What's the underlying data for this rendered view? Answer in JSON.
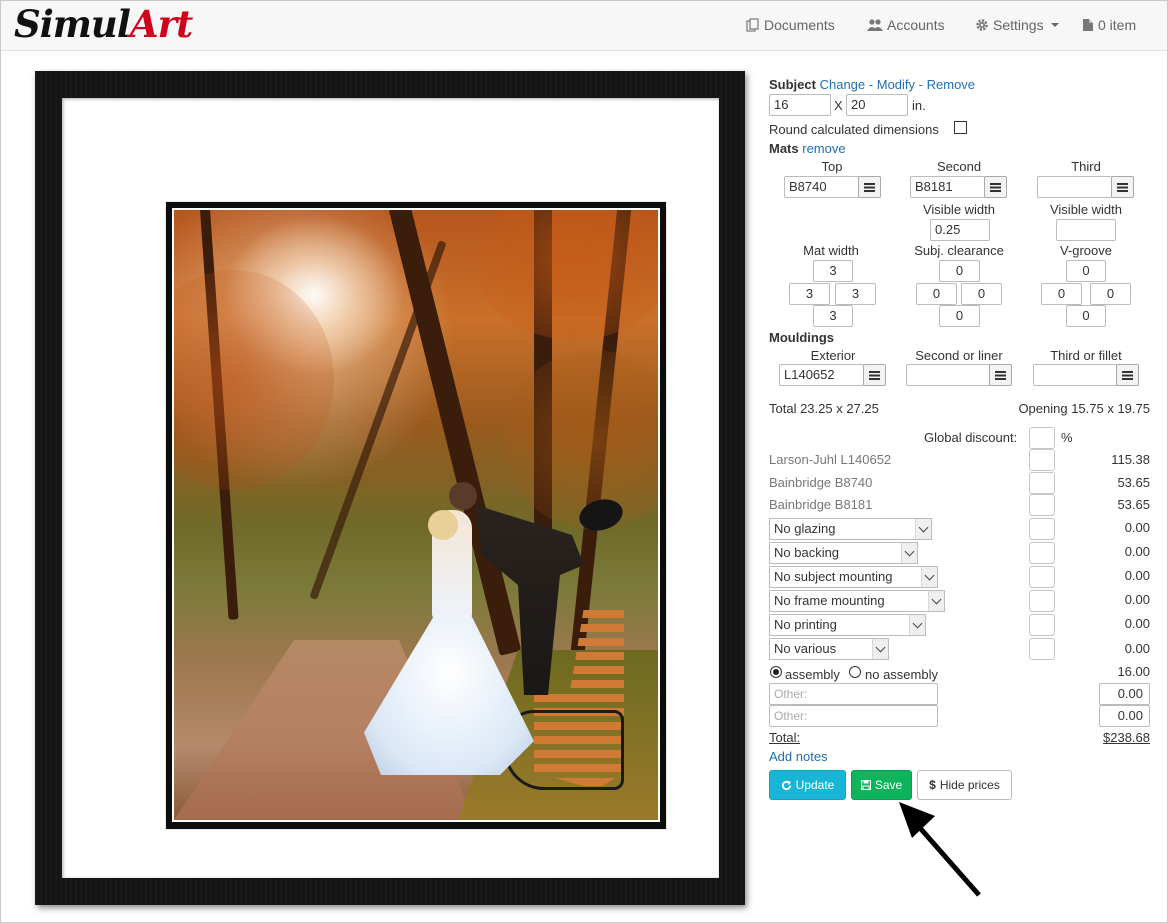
{
  "brand": {
    "part1": "Simul",
    "part2": "Art"
  },
  "nav": {
    "documents": "Documents",
    "accounts": "Accounts",
    "settings": "Settings",
    "cart": "0 item"
  },
  "subject": {
    "label": "Subject",
    "change": "Change",
    "sep1": "-",
    "modify": "Modify",
    "sep2": "-",
    "remove": "Remove",
    "width": "16",
    "times": "X",
    "height": "20",
    "unit": "in.",
    "round_label": "Round calculated dimensions"
  },
  "mats": {
    "label": "Mats",
    "remove": "remove",
    "col_top": "Top",
    "col_second": "Second",
    "col_third": "Third",
    "top_code": "B8740",
    "second_code": "B8181",
    "third_code": "",
    "visible_width_label": "Visible width",
    "second_visible_width": "0.25",
    "third_visible_width": "",
    "mat_width_label": "Mat width",
    "clearance_label": "Subj. clearance",
    "vgroove_label": "V-groove",
    "mat_width": {
      "top": "3",
      "left": "3",
      "right": "3",
      "bottom": "3"
    },
    "clearance": {
      "top": "0",
      "left": "0",
      "right": "0",
      "bottom": "0"
    },
    "vgroove": {
      "top": "0",
      "left": "0",
      "right": "0",
      "bottom": "0"
    }
  },
  "mouldings": {
    "label": "Mouldings",
    "col_exterior": "Exterior",
    "col_second": "Second or liner",
    "col_third": "Third or fillet",
    "exterior_code": "L140652",
    "second_code": "",
    "third_code": ""
  },
  "summary": {
    "total_dims": "Total 23.25 x 27.25",
    "opening_dims": "Opening 15.75 x 19.75",
    "global_discount_label": "Global discount:",
    "percent": "%"
  },
  "line_items": [
    {
      "name": "Larson-Juhl L140652",
      "price": "115.38"
    },
    {
      "name": "Bainbridge B8740",
      "price": "53.65"
    },
    {
      "name": "Bainbridge B8181",
      "price": "53.65"
    }
  ],
  "selects": [
    {
      "value": "No glazing",
      "price": "0.00"
    },
    {
      "value": "No backing",
      "price": "0.00"
    },
    {
      "value": "No subject mounting",
      "price": "0.00"
    },
    {
      "value": "No frame mounting",
      "price": "0.00"
    },
    {
      "value": "No printing",
      "price": "0.00"
    },
    {
      "value": "No various",
      "price": "0.00"
    }
  ],
  "assembly": {
    "assembly_label": "assembly",
    "no_assembly_label": "no assembly",
    "price": "16.00"
  },
  "other": [
    {
      "placeholder": "Other:",
      "price": "0.00"
    },
    {
      "placeholder": "Other:",
      "price": "0.00"
    }
  ],
  "total": {
    "label": "Total:",
    "value": "$238.68"
  },
  "add_notes": "Add notes",
  "buttons": {
    "update": "Update",
    "save": "Save",
    "hide_prices": "Hide prices"
  }
}
